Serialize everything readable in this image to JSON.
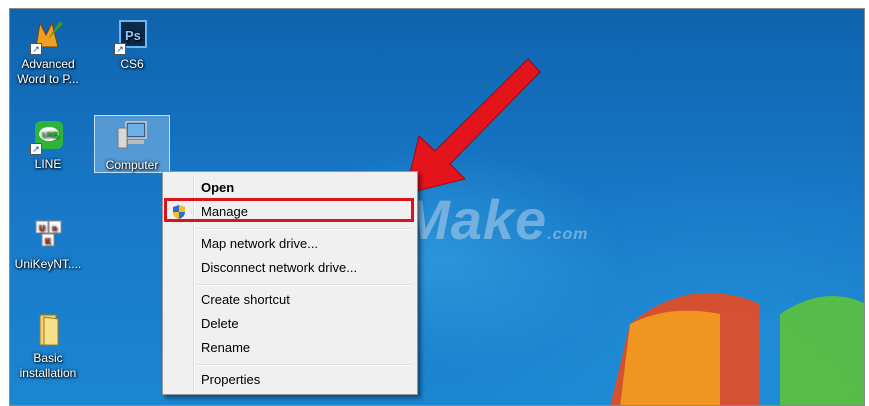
{
  "desktop": {
    "icons": [
      {
        "label_line1": "Advanced",
        "label_line2": "Word to P...",
        "icon": "word-to-pdf-icon"
      },
      {
        "label_line1": "CS6",
        "label_line2": "",
        "icon": "photoshop-icon"
      },
      {
        "label_line1": "LINE",
        "label_line2": "",
        "icon": "line-app-icon"
      },
      {
        "label_line1": "Computer",
        "label_line2": "",
        "icon": "computer-icon"
      },
      {
        "label_line1": "UniKeyNT....",
        "label_line2": "",
        "icon": "unikey-icon"
      },
      {
        "label_line1": "Basic",
        "label_line2": "installation",
        "icon": "folder-icon"
      }
    ]
  },
  "context_menu": {
    "items": [
      "Open",
      "Manage",
      "Map network drive...",
      "Disconnect network drive...",
      "Create shortcut",
      "Delete",
      "Rename",
      "Properties"
    ]
  },
  "watermark": {
    "text": "TipsMake",
    "suffix": ".com"
  },
  "colors": {
    "accent": "#d7141a",
    "desktop": "#1777c6"
  }
}
